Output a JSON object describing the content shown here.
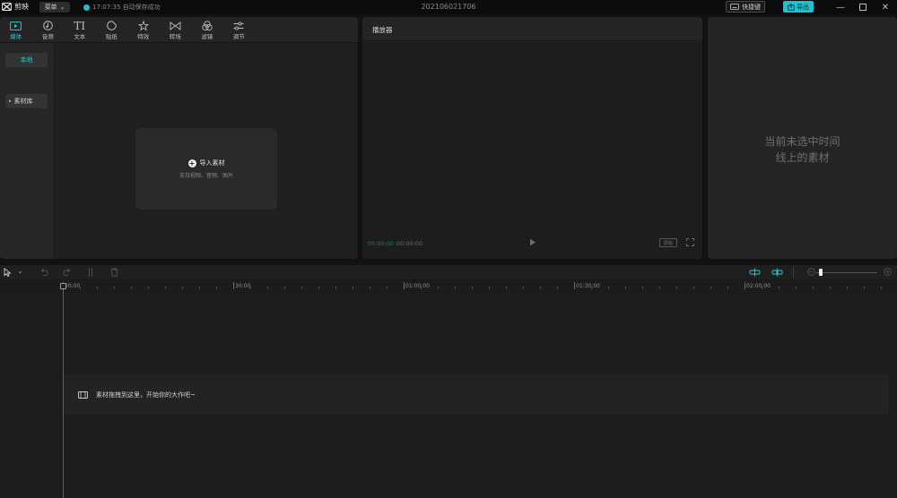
{
  "titlebar": {
    "app_name": "剪映",
    "menu_label": "菜单",
    "save_status": "17:07:35 自动保存成功",
    "project_name": "202106021706",
    "shortcut_label": "快捷键",
    "export_label": "导出",
    "accent": "#19c4cf"
  },
  "media_tabs": [
    {
      "label": "媒体",
      "icon": "media-icon",
      "active": true
    },
    {
      "label": "音频",
      "icon": "audio-icon",
      "active": false
    },
    {
      "label": "文本",
      "icon": "text-icon",
      "active": false
    },
    {
      "label": "贴纸",
      "icon": "sticker-icon",
      "active": false
    },
    {
      "label": "特效",
      "icon": "effects-icon",
      "active": false
    },
    {
      "label": "转场",
      "icon": "transition-icon",
      "active": false
    },
    {
      "label": "滤镜",
      "icon": "filter-icon",
      "active": false
    },
    {
      "label": "调节",
      "icon": "adjust-icon",
      "active": false
    }
  ],
  "media_sidebar": {
    "local_label": "本地",
    "library_label": "素材库"
  },
  "import_area": {
    "label": "导入素材",
    "hint": "支持视频、音频、图片"
  },
  "player": {
    "title": "播放器",
    "current_time": "00:00:00",
    "total_time": "00:00:00",
    "ratio_label": "原始"
  },
  "attributes": {
    "empty_line1": "当前未选中时间",
    "empty_line2": "线上的素材"
  },
  "timeline": {
    "ruler_labels": [
      "00:00",
      "30:00",
      "01:00:00",
      "01:30:00",
      "02:00:00"
    ],
    "drop_hint": "素材拖拽到这里，开始你的大作吧~"
  }
}
